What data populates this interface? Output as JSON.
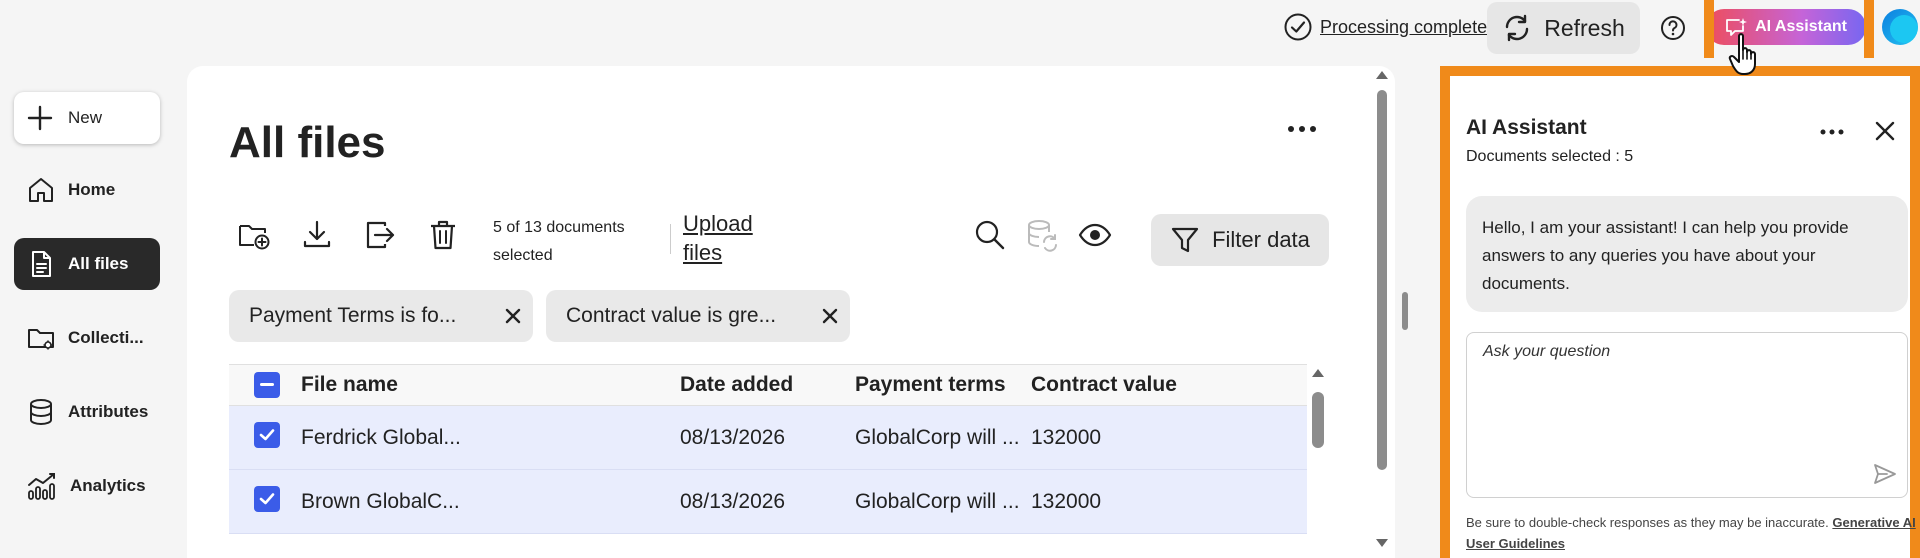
{
  "topbar": {
    "processing_label": "Processing complete",
    "refresh_label": "Refresh",
    "ai_button_label": "AI Assistant"
  },
  "sidebar": {
    "new_label": "New",
    "items": [
      {
        "label": "Home",
        "icon": "home-icon",
        "active": false
      },
      {
        "label": "All files",
        "icon": "file-icon",
        "active": true
      },
      {
        "label": "Collecti...",
        "icon": "folder-collection-icon",
        "active": false
      },
      {
        "label": "Attributes",
        "icon": "database-icon",
        "active": false
      },
      {
        "label": "Analytics",
        "icon": "analytics-icon",
        "active": false
      }
    ]
  },
  "main": {
    "title": "All files",
    "selection_text": "5 of 13 documents selected",
    "upload_label": "Upload files",
    "filter_label": "Filter data",
    "toolbar_icons": [
      "new-folder-icon",
      "download-icon",
      "export-icon",
      "trash-icon"
    ],
    "right_icons": [
      "search-icon",
      "sync-database-icon",
      "eye-icon"
    ],
    "chips": [
      {
        "label": "Payment Terms is fo..."
      },
      {
        "label": "Contract value is gre..."
      }
    ],
    "table": {
      "columns": [
        "File name",
        "Date added",
        "Payment terms",
        "Contract value"
      ],
      "rows": [
        {
          "file": "Ferdrick Global...",
          "date": "08/13/2026",
          "terms": "GlobalCorp will ...",
          "value": "132000",
          "checked": true
        },
        {
          "file": "Brown GlobalC...",
          "date": "08/13/2026",
          "terms": "GlobalCorp will ...",
          "value": "132000",
          "checked": true
        }
      ]
    }
  },
  "ai_panel": {
    "title": "AI Assistant",
    "subtitle": "Documents selected : 5",
    "message": "Hello, I am your assistant! I can help you provide answers to any queries you have about your documents.",
    "input_placeholder": "Ask your question",
    "disclaimer": "Be sure to double-check responses as they may be inaccurate.",
    "guidelines_link": "Generative AI User Guidelines"
  },
  "colors": {
    "accent_blue": "#3b5ce8",
    "highlight_orange": "#f08a1a",
    "active_nav": "#292929",
    "selected_row": "#e9edfd"
  }
}
